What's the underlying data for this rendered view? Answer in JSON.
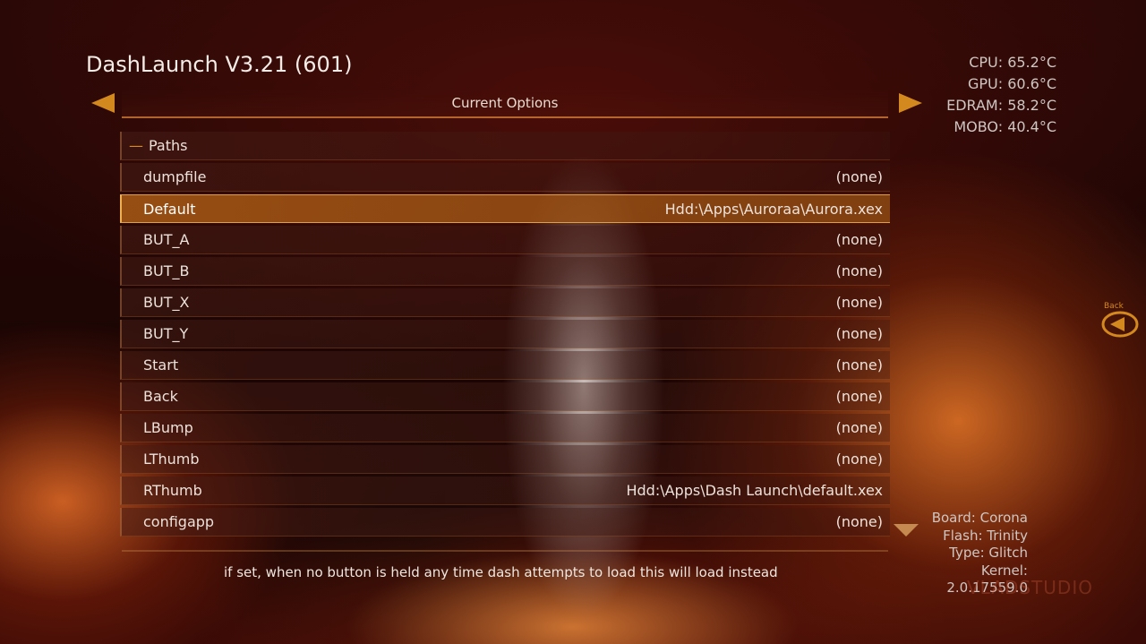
{
  "app": {
    "title": "DashLaunch V3.21 (601)"
  },
  "header": {
    "title": "Current Options"
  },
  "temps": [
    {
      "text": "CPU: 65.2°C"
    },
    {
      "text": "GPU: 60.6°C"
    },
    {
      "text": "EDRAM: 58.2°C"
    },
    {
      "text": "MOBO: 40.4°C"
    }
  ],
  "section": {
    "dash": "—",
    "label": "Paths"
  },
  "rows": [
    {
      "label": "dumpfile",
      "value": "(none)"
    },
    {
      "label": "Default",
      "value": "Hdd:\\Apps\\Auroraa\\Aurora.xex",
      "selected": true
    },
    {
      "label": "BUT_A",
      "value": "(none)"
    },
    {
      "label": "BUT_B",
      "value": "(none)"
    },
    {
      "label": "BUT_X",
      "value": "(none)"
    },
    {
      "label": "BUT_Y",
      "value": "(none)"
    },
    {
      "label": "Start",
      "value": "(none)"
    },
    {
      "label": "Back",
      "value": "(none)"
    },
    {
      "label": "LBump",
      "value": "(none)"
    },
    {
      "label": "LThumb",
      "value": "(none)"
    },
    {
      "label": "RThumb",
      "value": "Hdd:\\Apps\\Dash Launch\\default.xex"
    },
    {
      "label": "configapp",
      "value": "(none)"
    }
  ],
  "description": "if set, when no button is held any time dash attempts to load this will load instead",
  "sysinfo": [
    {
      "text": "Board: Corona"
    },
    {
      "text": "Flash: Trinity"
    },
    {
      "text": "Type: Glitch"
    },
    {
      "text": "Kernel: 2.0.17559.0"
    }
  ],
  "back_button": {
    "label": "Back",
    "icon": "back-arrow-icon"
  },
  "watermark": "VLADSTUDIO",
  "colors": {
    "accent": "#d4891e",
    "selected": "#a85a18"
  }
}
